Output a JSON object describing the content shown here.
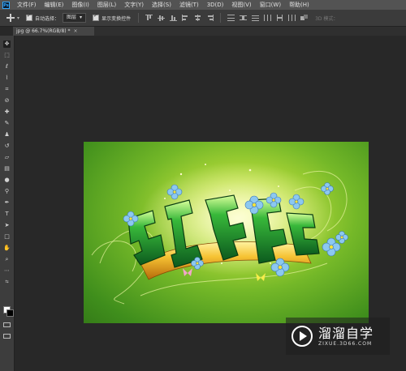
{
  "app": {
    "logo_text": "Ps"
  },
  "menu": [
    "文件(F)",
    "编辑(E)",
    "图像(I)",
    "图层(L)",
    "文字(Y)",
    "选择(S)",
    "滤镜(T)",
    "3D(D)",
    "视图(V)",
    "窗口(W)",
    "帮助(H)"
  ],
  "options": {
    "auto_select_label": "自动选择：",
    "auto_select_value": "图层",
    "show_transform_label": "显示变换控件",
    "mode_3d_label": "3D 模式："
  },
  "document_tab": {
    "title": "jpg @ 66.7%(RGB/8) *",
    "close": "×"
  },
  "colors": {
    "foreground": "#ffffff",
    "background": "#000000",
    "accent": "#31a8ff"
  },
  "watermark": {
    "title": "溜溜自学",
    "subtitle": "ZIXUE.3D66.COM"
  },
  "icons": [
    "move-icon",
    "marquee-icon",
    "lasso-icon",
    "quick-select-icon",
    "crop-icon",
    "eyedropper-icon",
    "healing-icon",
    "brush-icon",
    "clone-stamp-icon",
    "history-brush-icon",
    "eraser-icon",
    "gradient-icon",
    "blur-icon",
    "dodge-icon",
    "pen-icon",
    "type-icon",
    "path-select-icon",
    "shape-icon",
    "hand-icon",
    "zoom-icon"
  ]
}
